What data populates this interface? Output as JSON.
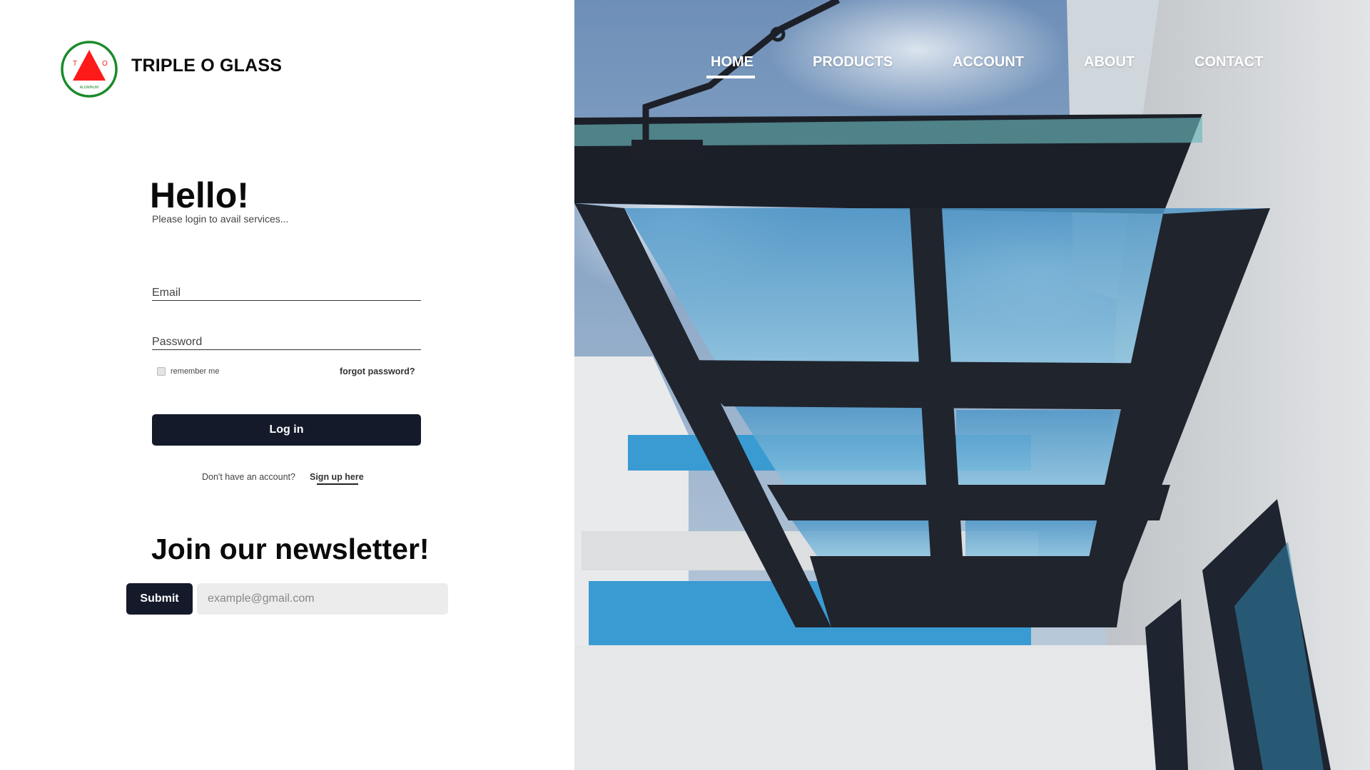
{
  "brand": {
    "name": "TRIPLE O GLASS",
    "logo_letters": {
      "left": "T",
      "right": "O",
      "bottom": "ALUMINUM"
    },
    "colors": {
      "ring": "#1a8a2a",
      "triangle": "#ff1a1a"
    }
  },
  "login": {
    "title": "Hello!",
    "subtitle": "Please login to avail services...",
    "email_placeholder": "Email",
    "password_placeholder": "Password",
    "remember_label": "remember me",
    "forgot_label": "forgot password?",
    "login_button": "Log in",
    "no_account_text": "Don't have an account?",
    "signup_link": "Sign up here"
  },
  "newsletter": {
    "title": "Join our newsletter!",
    "submit_label": "Submit",
    "email_placeholder": "example@gmail.com"
  },
  "nav": {
    "items": [
      {
        "label": "HOME",
        "active": true
      },
      {
        "label": "PRODUCTS",
        "active": false
      },
      {
        "label": "ACCOUNT",
        "active": false
      },
      {
        "label": "ABOUT",
        "active": false
      },
      {
        "label": "CONTACT",
        "active": false
      }
    ]
  },
  "theme": {
    "button_bg": "#141a2a",
    "input_bg": "#ececec"
  }
}
